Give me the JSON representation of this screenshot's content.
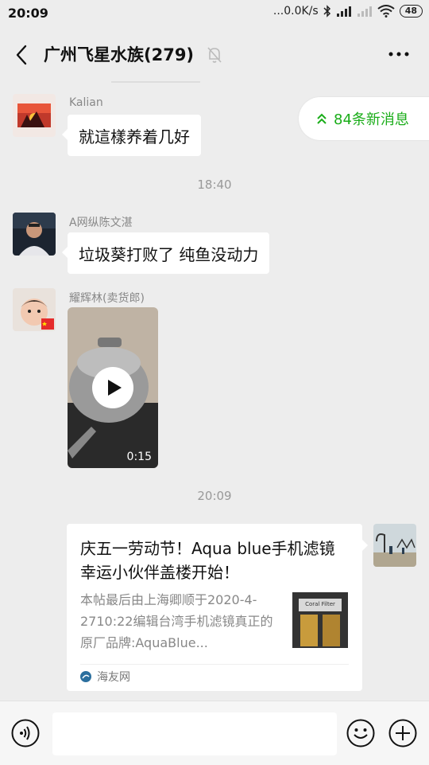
{
  "status_bar": {
    "time": "20:09",
    "network_speed": "...0.0K/s",
    "battery": "48"
  },
  "header": {
    "title": "广州飞星水族(279)"
  },
  "new_messages": {
    "label": "84条新消息"
  },
  "messages": [
    {
      "sender": "Kalian",
      "text": "就這樣养着几好"
    },
    {
      "timestamp": "18:40"
    },
    {
      "sender": "A网纵陈文湛",
      "text": "垃圾葵打败了 纯鱼没动力"
    },
    {
      "sender": "耀辉林(卖货郎)",
      "video_duration": "0:15"
    },
    {
      "timestamp": "20:09"
    },
    {
      "link_card": {
        "title": "庆五一劳动节！Aqua blue手机滤镜幸运小伙伴盖楼开始！",
        "description": "本帖最后由上海卿顺于2020-4-2710:22编辑台湾手机滤镜真正的原厂品牌:AquaBlue...",
        "thumb_text": "Coral Filter",
        "source": "海友网"
      }
    }
  ],
  "colors": {
    "background": "#ededed",
    "accent_green": "#1aad19",
    "bubble": "#ffffff"
  }
}
